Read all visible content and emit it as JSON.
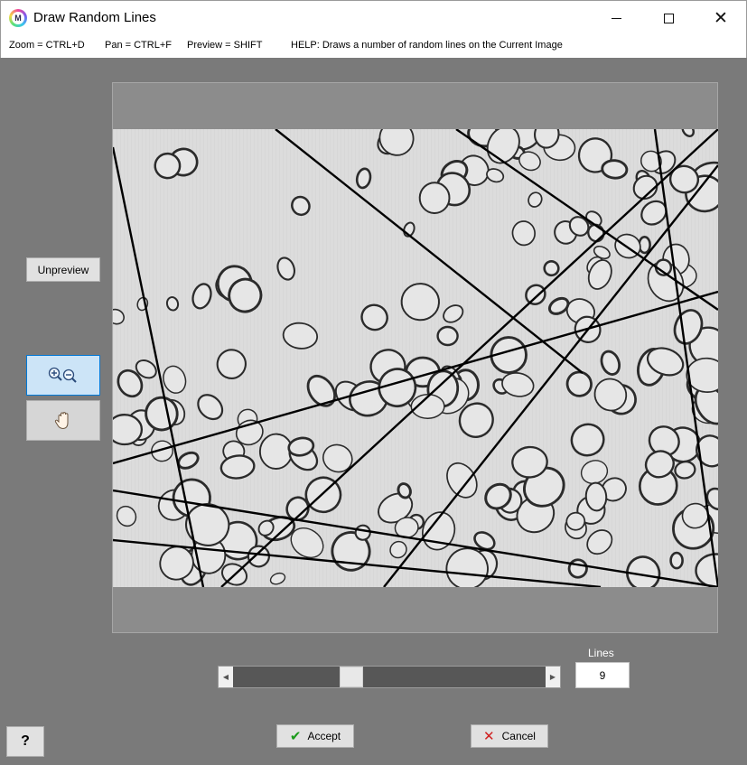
{
  "window": {
    "title": "Draw Random Lines",
    "app_icon_letter": "M",
    "min_icon": "minimize-icon",
    "max_icon": "maximize-icon",
    "close_icon": "close-icon"
  },
  "helpbar": {
    "zoom": "Zoom = CTRL+D",
    "pan": "Pan = CTRL+F",
    "preview": "Preview = SHIFT",
    "help": "HELP:  Draws a number of random lines on the Current Image"
  },
  "tools": {
    "unpreview_label": "Unpreview",
    "zoom_icon": "zoom-in-out-icon",
    "pan_icon": "hand-pan-icon"
  },
  "controls": {
    "lines_label": "Lines",
    "lines_value": "9",
    "slider_min": 1,
    "slider_max": 50,
    "slider_value": 9
  },
  "buttons": {
    "help_label": "?",
    "accept_label": "Accept",
    "cancel_label": "Cancel"
  },
  "colors": {
    "background": "#7a7a7a",
    "accent": "#0078d7",
    "accept_check": "#1a9a1a",
    "cancel_x": "#d02020"
  }
}
